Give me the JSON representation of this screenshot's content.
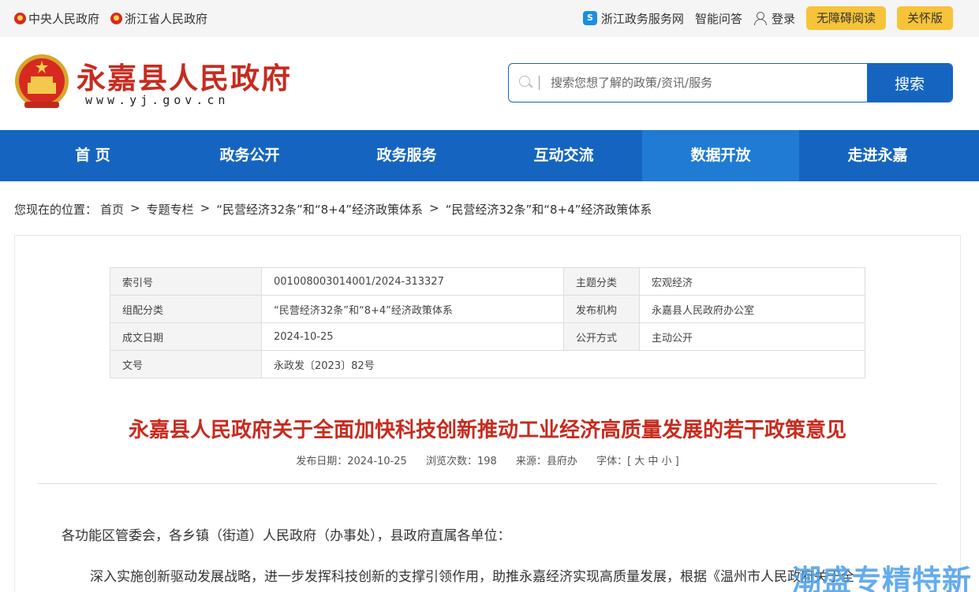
{
  "topbar": {
    "left_links": [
      "中央人民政府",
      "浙江省人民政府"
    ],
    "zj_service": "浙江政务服务网",
    "smart_qa": "智能问答",
    "login": "登录",
    "accessible_read": "无障碍阅读",
    "care_mode": "关怀版"
  },
  "header": {
    "site_name": "永嘉县人民政府",
    "site_url": "www.yj.gov.cn",
    "search_placeholder": "搜索您想了解的政策/资讯/服务",
    "search_button": "搜索"
  },
  "nav": {
    "items": [
      "首 页",
      "政务公开",
      "政务服务",
      "互动交流",
      "数据开放",
      "走进永嘉"
    ],
    "active_index": 4
  },
  "breadcrumb": {
    "prefix": "您现在的位置：",
    "items": [
      "首页",
      "专题专栏",
      "“民营经济32条”和“8+4”经济政策体系",
      "“民营经济32条”和“8+4”经济政策体系"
    ],
    "separator": ">"
  },
  "meta": {
    "index_label": "索引号",
    "index_value": "001008003014001/2024-313327",
    "topic_label": "主题分类",
    "topic_value": "宏观经济",
    "group_label": "组配分类",
    "group_value": "“民营经济32条”和“8+4”经济政策体系",
    "publisher_label": "发布机构",
    "publisher_value": "永嘉县人民政府办公室",
    "date_label": "成文日期",
    "date_value": "2024-10-25",
    "open_label": "公开方式",
    "open_value": "主动公开",
    "docno_label": "文号",
    "docno_value": "永政发〔2023〕82号"
  },
  "article": {
    "title": "永嘉县人民政府关于全面加快科技创新推动工业经济高质量发展的若干政策意见",
    "publish_date": "发布日期：2024-10-25",
    "views": "浏览次数：198",
    "source": "来源：县府办",
    "font_size": "字体：[ 大 中 小 ]",
    "para1": "各功能区管委会，各乡镇（街道）人民政府（办事处），县政府直属各单位：",
    "para2": "深入实施创新驱动发展战略，进一步发挥科技创新的支撑引领作用，助推永嘉经济实现高质量发展，根据《温州市人民政府关于全"
  },
  "watermark": "潮盛专精特新",
  "colors": {
    "brand_red": "#c72b1f",
    "nav_blue": "#1565c0",
    "nav_active": "#1f7bd4",
    "pill_yellow": "#f7c338"
  }
}
